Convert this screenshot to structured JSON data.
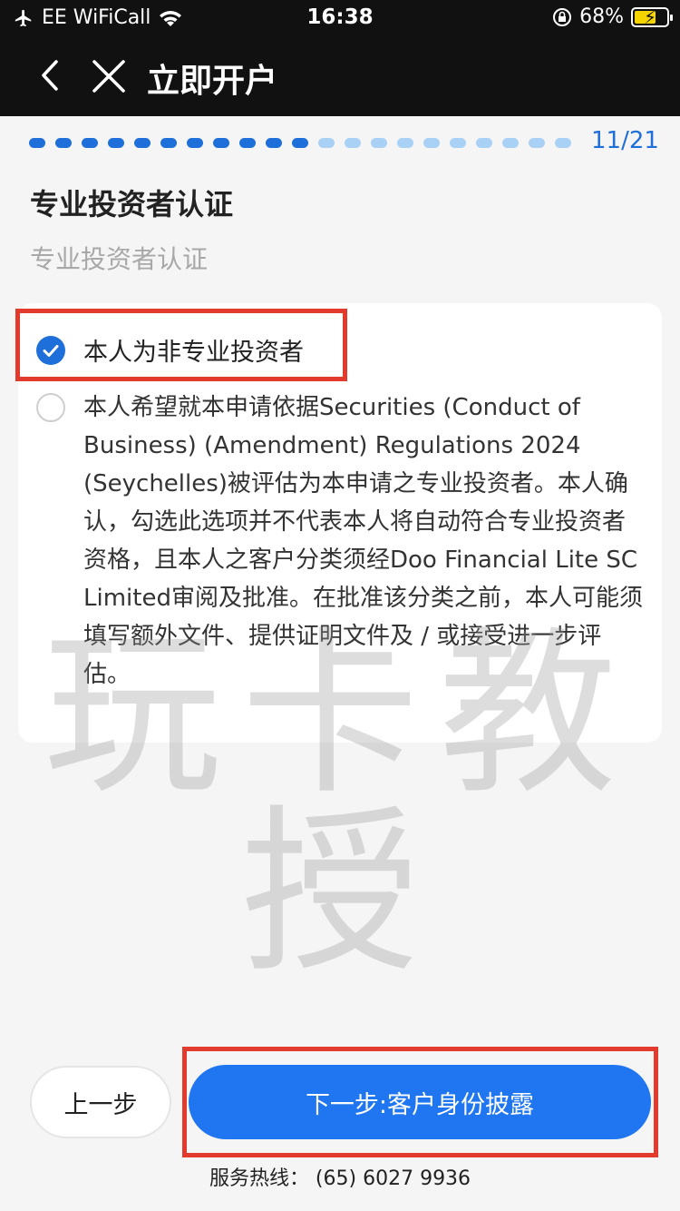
{
  "status_bar": {
    "carrier": "EE WiFiCall",
    "time": "16:38",
    "battery_percent_label": "68%",
    "battery_level": 0.68
  },
  "nav": {
    "title": "立即开户",
    "back_icon": "chevron-left-icon",
    "close_icon": "close-icon"
  },
  "progress": {
    "current": 11,
    "total": 21,
    "label": "11/21",
    "active_color": "#1e6fd9",
    "inactive_color": "#a9d1f5"
  },
  "section": {
    "title": "专业投资者认证",
    "subtitle": "专业投资者认证"
  },
  "options": [
    {
      "label": "本人为非专业投资者",
      "selected": true
    },
    {
      "label": "本人希望就本申请依据Securities (Conduct of Business) (Amendment) Regulations 2024 (Seychelles)被评估为本申请之专业投资者。本人确认，勾选此选项并不代表本人将自动符合专业投资者资格，且本人之客户分类须经Doo Financial Lite SC Limited审阅及批准。在批准该分类之前，本人可能须填写额外文件、提供证明文件及 / 或接受进一步评估。",
      "selected": false
    }
  ],
  "watermark": "玩卡教授",
  "buttons": {
    "prev": "上一步",
    "next": "下一步:客户身份披露"
  },
  "hotline": "服务热线： (65) 6027 9936",
  "colors": {
    "accent": "#1f76f0",
    "highlight": "#e23b2e"
  }
}
